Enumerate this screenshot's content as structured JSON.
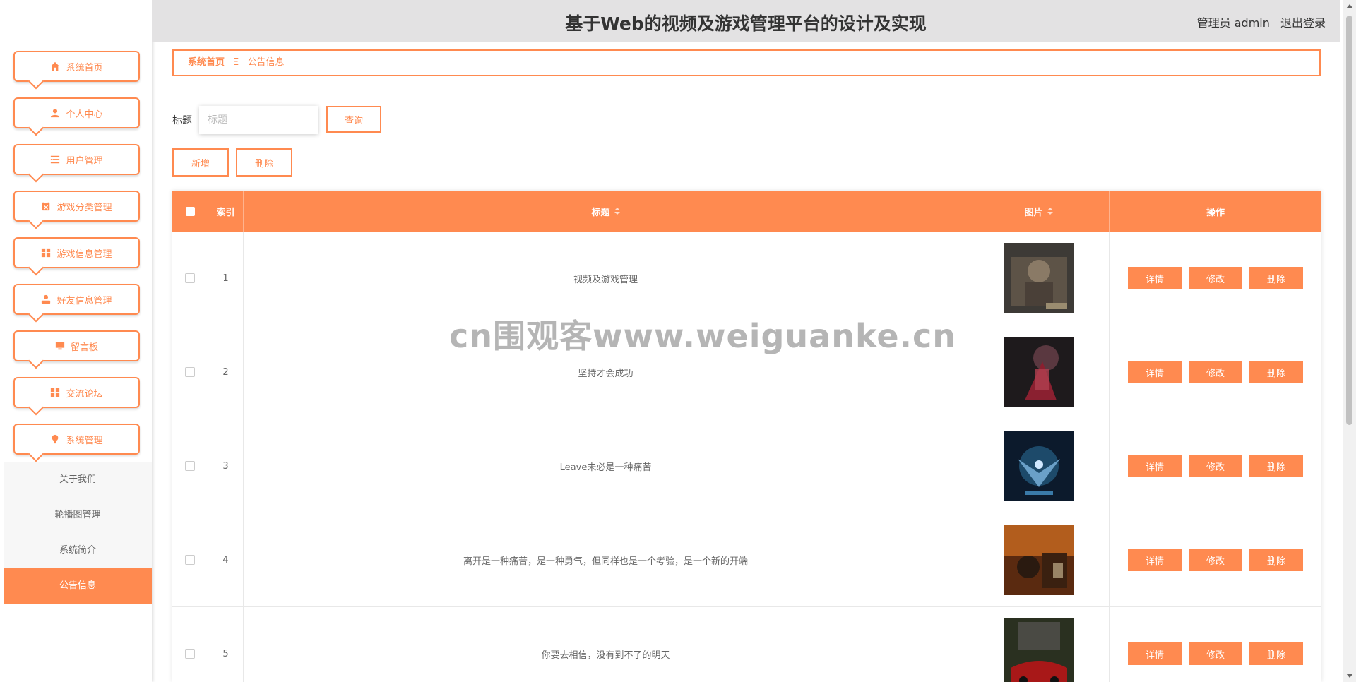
{
  "header": {
    "title": "基于Web的视频及游戏管理平台的设计及实现",
    "role": "管理员 admin",
    "logout": "退出登录"
  },
  "sidebar": {
    "items": [
      {
        "label": "系统首页",
        "icon": "home-icon"
      },
      {
        "label": "个人中心",
        "icon": "user-icon"
      },
      {
        "label": "用户管理",
        "icon": "list-icon"
      },
      {
        "label": "游戏分类管理",
        "icon": "clipboard-icon"
      },
      {
        "label": "游戏信息管理",
        "icon": "grid-icon"
      },
      {
        "label": "好友信息管理",
        "icon": "person-icon"
      },
      {
        "label": "留言板",
        "icon": "monitor-icon"
      },
      {
        "label": "交流论坛",
        "icon": "grid-icon"
      },
      {
        "label": "系统管理",
        "icon": "bulb-icon"
      }
    ],
    "submenu": [
      {
        "label": "关于我们",
        "active": false
      },
      {
        "label": "轮播图管理",
        "active": false
      },
      {
        "label": "系统简介",
        "active": false
      },
      {
        "label": "公告信息",
        "active": true
      }
    ]
  },
  "breadcrumb": {
    "home": "系统首页",
    "separator": "Ξ",
    "current": "公告信息"
  },
  "search": {
    "label": "标题",
    "placeholder": "标题",
    "value": "",
    "button": "查询"
  },
  "actions": {
    "add": "新增",
    "delete": "删除"
  },
  "table": {
    "headers": {
      "index": "索引",
      "title": "标题",
      "image": "图片",
      "ops": "操作"
    },
    "rows": [
      {
        "index": "1",
        "title": "视频及游戏管理"
      },
      {
        "index": "2",
        "title": "坚持才会成功"
      },
      {
        "index": "3",
        "title": "Leave未必是一种痛苦"
      },
      {
        "index": "4",
        "title": "离开是一种痛苦，是一种勇气，但同样也是一个考验，是一个新的开端"
      },
      {
        "index": "5",
        "title": "你要去相信，没有到不了的明天"
      }
    ],
    "op_labels": {
      "detail": "详情",
      "edit": "修改",
      "delete": "删除"
    }
  },
  "watermark": "cn围观客www.weiguanke.cn",
  "colors": {
    "accent": "#ff8a50",
    "header_bg": "#e3e2e3"
  }
}
